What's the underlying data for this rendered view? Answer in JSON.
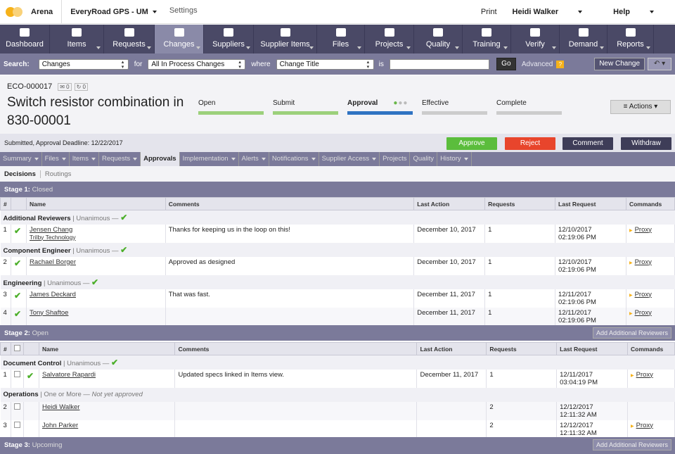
{
  "topbar": {
    "brand": "Arena",
    "workspace": "EveryRoad GPS - UM",
    "settings": "Settings",
    "print": "Print",
    "user": "Heidi Walker",
    "help": "Help"
  },
  "nav": [
    {
      "label": "Dashboard",
      "icon": "home-icon",
      "w": 71
    },
    {
      "label": "Items",
      "icon": "items-icon",
      "w": 77
    },
    {
      "label": "Requests",
      "icon": "requests-icon",
      "w": 72
    },
    {
      "label": "Changes",
      "icon": "changes-icon",
      "w": 70
    },
    {
      "label": "Suppliers",
      "icon": "truck-icon",
      "w": 71
    },
    {
      "label": "Supplier Items",
      "icon": "box-icon",
      "w": 90
    },
    {
      "label": "Files",
      "icon": "file-icon",
      "w": 68
    },
    {
      "label": "Projects",
      "icon": "briefcase-icon",
      "w": 70
    },
    {
      "label": "Quality",
      "icon": "refresh-icon",
      "w": 69
    },
    {
      "label": "Training",
      "icon": "book-icon",
      "w": 69
    },
    {
      "label": "Verify",
      "icon": "check-icon",
      "w": 69
    },
    {
      "label": "Demand",
      "icon": "chart-icon",
      "w": 68
    },
    {
      "label": "Reports",
      "icon": "report-icon",
      "w": 66
    }
  ],
  "search": {
    "label": "Search:",
    "type": "Changes",
    "for": "for",
    "scope": "All In Process Changes",
    "where": "where",
    "field": "Change Title",
    "is": "is",
    "go": "Go",
    "advanced": "Advanced",
    "help": "?",
    "new_change": "New Change",
    "back": "↶ ▾"
  },
  "eco": {
    "number": "ECO-000017",
    "count1": "0",
    "count2": "0",
    "title": "Switch resistor combination in 830-00001",
    "steps": [
      {
        "label": "Open",
        "state": "done"
      },
      {
        "label": "Submit",
        "state": "done"
      },
      {
        "label": "Approval",
        "state": "cur"
      },
      {
        "label": "Effective",
        "state": "todo"
      },
      {
        "label": "Complete",
        "state": "todo"
      }
    ],
    "actions": "≡ Actions ▾",
    "submitted": "Submitted, Approval Deadline: 12/22/2017"
  },
  "buttons": {
    "approve": "Approve",
    "reject": "Reject",
    "comment": "Comment",
    "withdraw": "Withdraw"
  },
  "tabs": [
    "Summary",
    "Files",
    "Items",
    "Requests",
    "Approvals",
    "Implementation",
    "Alerts",
    "Notifications",
    "Supplier Access",
    "Projects",
    "Quality",
    "History"
  ],
  "subtabs": {
    "decisions": "Decisions",
    "routings": "Routings"
  },
  "stage1": {
    "label": "Stage 1:",
    "status": "Closed"
  },
  "stage2": {
    "label": "Stage 2:",
    "status": "Open",
    "add": "Add Additional Reviewers"
  },
  "stage3": {
    "label": "Stage 3:",
    "status": "Upcoming",
    "add": "Add Additional Reviewers"
  },
  "columns": {
    "num": "#",
    "name": "Name",
    "comments": "Comments",
    "last_action": "Last Action",
    "requests": "Requests",
    "last_request": "Last Request",
    "commands": "Commands"
  },
  "s1": {
    "g1": {
      "name": "Additional Reviewers",
      "rule": "| Unanimous —"
    },
    "r1": {
      "n": "1",
      "name": "Jensen Chang",
      "org": "Trilby Technology",
      "comment": "Thanks for keeping us in the loop on this!",
      "action": "December 10, 2017",
      "req": "1",
      "d": "12/10/2017",
      "t": "02:19:06 PM",
      "cmd": "Proxy"
    },
    "g2": {
      "name": "Component Engineer",
      "rule": "| Unanimous —"
    },
    "r2": {
      "n": "2",
      "name": "Rachael Borger",
      "comment": "Approved as designed",
      "action": "December 10, 2017",
      "req": "1",
      "d": "12/10/2017",
      "t": "02:19:06 PM",
      "cmd": "Proxy"
    },
    "g3": {
      "name": "Engineering",
      "rule": "| Unanimous —"
    },
    "r3": {
      "n": "3",
      "name": "James Deckard",
      "comment": "That was fast.",
      "action": "December 11, 2017",
      "req": "1",
      "d": "12/11/2017",
      "t": "02:19:06 PM",
      "cmd": "Proxy"
    },
    "r4": {
      "n": "4",
      "name": "Tony Shaftoe",
      "comment": "",
      "action": "December 11, 2017",
      "req": "1",
      "d": "12/11/2017",
      "t": "02:19:06 PM",
      "cmd": "Proxy"
    }
  },
  "s2": {
    "g1": {
      "name": "Document Control",
      "rule": "| Unanimous —"
    },
    "r1": {
      "n": "1",
      "name": "Salvatore Rapardi",
      "comment": "Updated specs linked in Items view.",
      "action": "December 11, 2017",
      "req": "1",
      "d": "12/11/2017",
      "t": "03:04:19 PM",
      "cmd": "Proxy"
    },
    "g2": {
      "name": "Operations",
      "rule": "| One or More —",
      "note": "Not yet approved"
    },
    "r2": {
      "n": "2",
      "name": "Heidi Walker",
      "req": "2",
      "d": "12/12/2017",
      "t": "12:11:32 AM"
    },
    "r3": {
      "n": "3",
      "name": "John Parker",
      "req": "2",
      "d": "12/12/2017",
      "t": "12:11:32 AM",
      "cmd": "Proxy"
    }
  },
  "colors": {
    "approve": "#5bbd3c",
    "reject": "#e8452c",
    "dark": "#3e3d58",
    "nav": "#4a4966",
    "bar": "#7b7a9a"
  }
}
